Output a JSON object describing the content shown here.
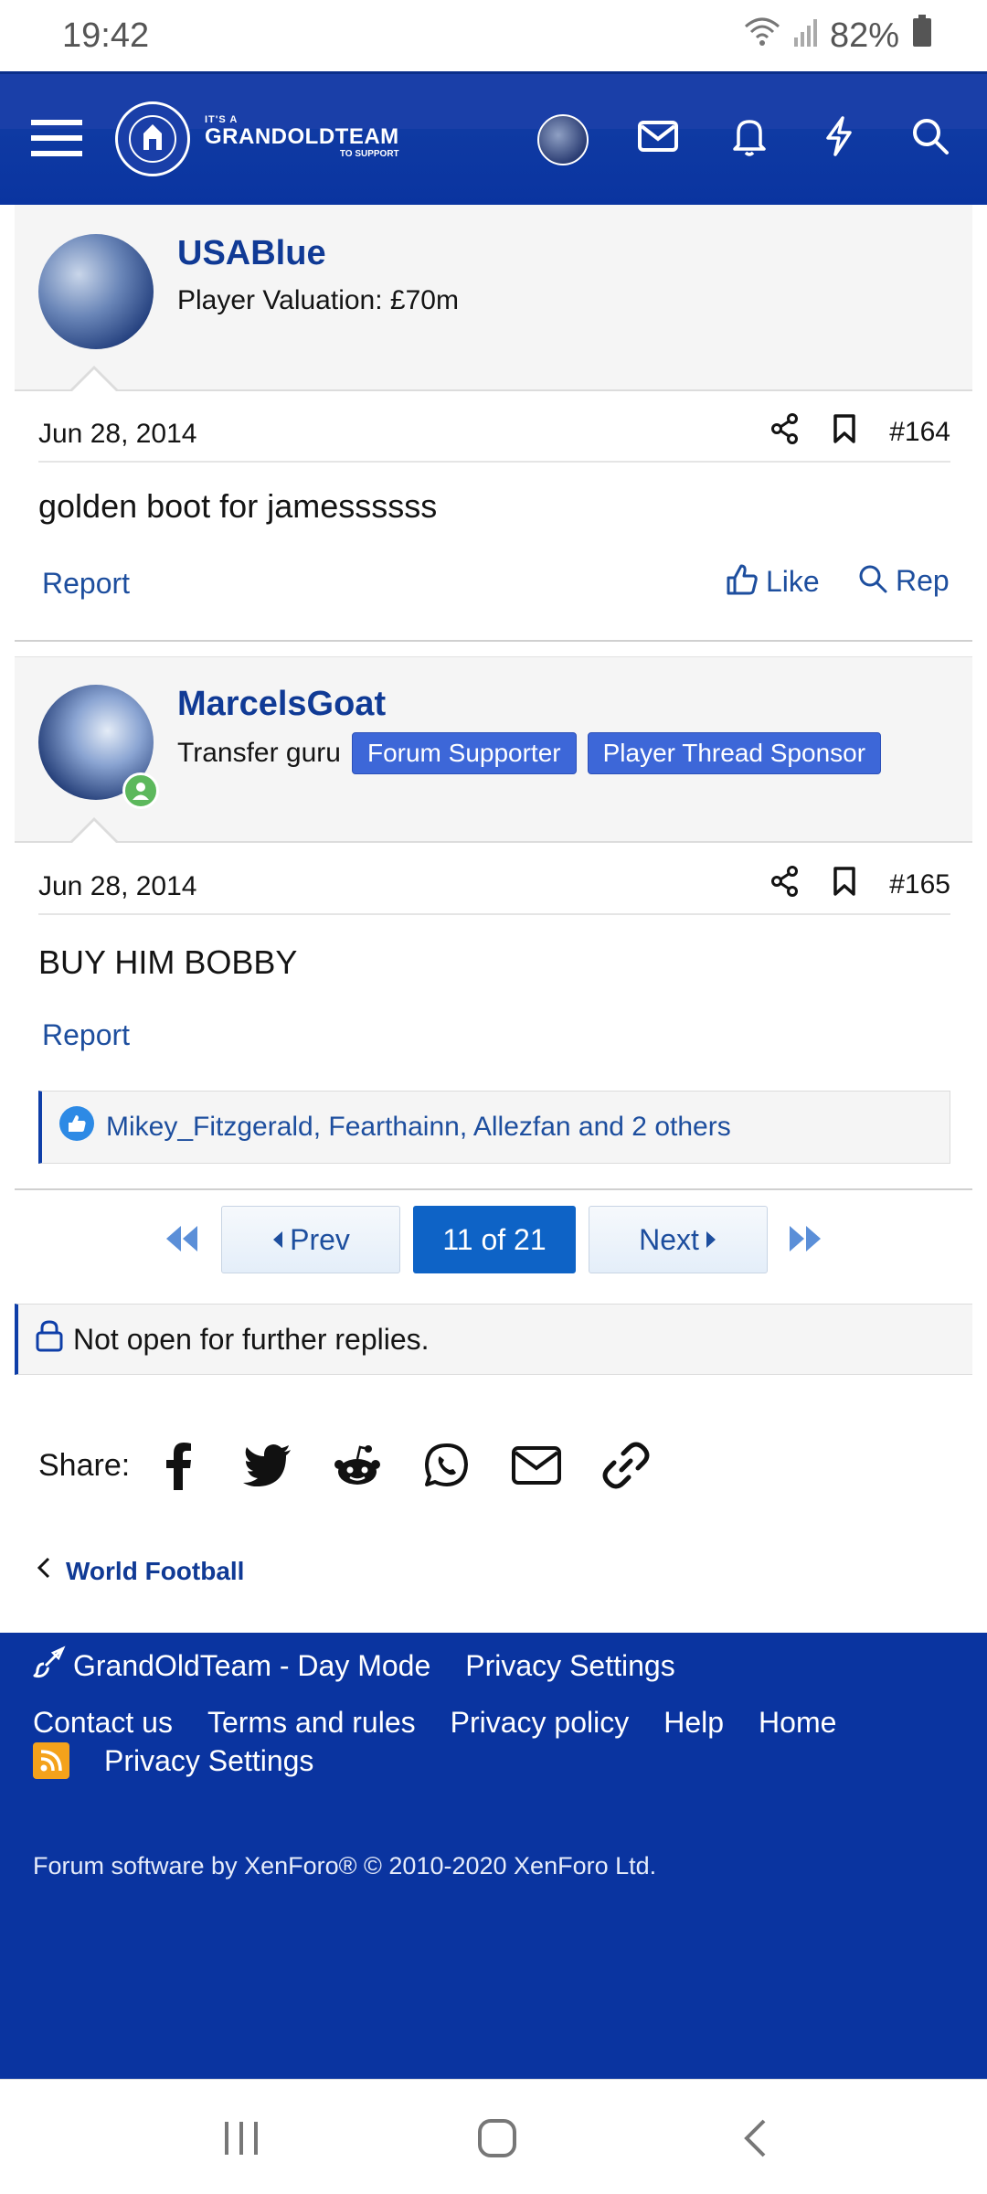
{
  "status_bar": {
    "time": "19:42",
    "battery": "82%"
  },
  "header": {
    "logo": {
      "line1": "IT'S A",
      "line2": "GRANDOLDTEAM",
      "line3": "TO SUPPORT"
    }
  },
  "posts": [
    {
      "username": "USABlue",
      "user_title": "Player Valuation: £70m",
      "badges": [],
      "date": "Jun 28, 2014",
      "post_number": "#164",
      "body": "golden boot for jamessssss",
      "report_label": "Report",
      "like_label": "Like",
      "reply_label": "Rep"
    },
    {
      "username": "MarcelsGoat",
      "user_title": "Transfer guru",
      "badges": [
        "Forum Supporter",
        "Player Thread Sponsor"
      ],
      "date": "Jun 28, 2014",
      "post_number": "#165",
      "body": "BUY HIM BOBBY",
      "report_label": "Report",
      "reactions": "Mikey_Fitzgerald, Fearthainn, Allezfan and 2 others"
    }
  ],
  "pagination": {
    "prev_label": "Prev",
    "current": "11 of 21",
    "next_label": "Next"
  },
  "locked_notice": "Not open for further replies.",
  "share": {
    "label": "Share:",
    "icons": [
      "facebook-icon",
      "twitter-icon",
      "reddit-icon",
      "whatsapp-icon",
      "email-icon",
      "link-icon"
    ]
  },
  "breadcrumb": {
    "label": "World Football"
  },
  "footer": {
    "style_chooser": "GrandOldTeam - Day Mode",
    "privacy_settings_top": "Privacy Settings",
    "links": [
      "Contact us",
      "Terms and rules",
      "Privacy policy",
      "Help",
      "Home"
    ],
    "privacy_settings_bottom": "Privacy Settings",
    "copyright": "Forum software by XenForo® © 2010-2020 XenForo Ltd."
  },
  "colors": {
    "brand_blue": "#0a34a0",
    "link_blue": "#1d4e9e",
    "badge_blue": "#3d67d8",
    "page_current": "#0e63c6",
    "online_green": "#5cb85c"
  }
}
